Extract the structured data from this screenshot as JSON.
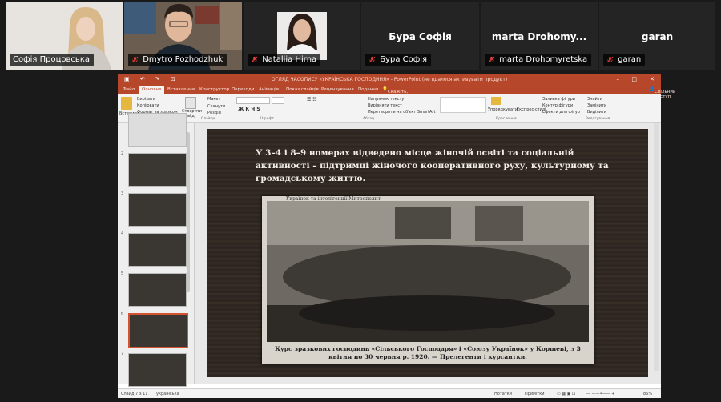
{
  "participants": [
    {
      "name": "Софія Процовська",
      "muted": false,
      "active_speaker": true,
      "has_video": true
    },
    {
      "name": "Dmytro Pozhodzhuk",
      "muted": true,
      "has_video": true
    },
    {
      "name": "Nataliia Hirna",
      "muted": true,
      "has_video": true
    },
    {
      "name": "Бура Софія",
      "display_name": "Бура Софія",
      "muted": true,
      "has_video": false
    },
    {
      "name": "marta Drohomyretska",
      "display_name": "marta Drohomy...",
      "muted": true,
      "has_video": false
    },
    {
      "name": "garan",
      "display_name": "garan",
      "muted": true,
      "has_video": false
    }
  ],
  "app": {
    "title": "ОГЛЯД ЧАСОПИСУ «УКРАЇНСЬКА ГОСПОДИНЯ» - PowerPoint (не вдалося активувати продукт)",
    "tabs": [
      "Файл",
      "Основне",
      "Вставлення",
      "Конструктор",
      "Переходи",
      "Анімація",
      "Показ слайдів",
      "Рецензування",
      "Подання"
    ],
    "tell_me": "Скажіть, що потрібно зробити",
    "share": "Спільний доступ",
    "ribbon_groups": [
      "Буфер обміну",
      "Слайди",
      "Шрифт",
      "Абзац",
      "Креслення",
      "Редагування"
    ],
    "clipboard": [
      "Вирізати",
      "Копіювати",
      "Формат за зразком"
    ],
    "paste": "Вставити",
    "new_slide": "Створити слайд",
    "slides_cmds": [
      "Макет",
      "Скинути",
      "Розділ"
    ],
    "drawing_cmds": [
      "Упорядкувати",
      "Експрес-стилі"
    ],
    "shape_cmds": [
      "Заливка фігури",
      "Контур фігури",
      "Ефекти для фігур"
    ],
    "editing_cmds": [
      "Знайти",
      "Замінити",
      "Виділити"
    ],
    "paragraph_cmds": [
      "Напрямок тексту",
      "Вирівняти текст",
      "Перетворити на об'єкт SmartArt"
    ]
  },
  "thumbnails": [
    {
      "num": "2"
    },
    {
      "num": "3"
    },
    {
      "num": "4"
    },
    {
      "num": "5"
    },
    {
      "num": "6"
    },
    {
      "num": "7",
      "selected": true
    },
    {
      "num": "8"
    }
  ],
  "slide": {
    "text": "У 3–4 і 8–9 номерах відведено місце жіночій освіті та соціальній активності – підтримці жіночого кооперативного руху, культурному та громадському життю.",
    "photo_tag": "Українок та інтелігенції Митрополит",
    "caption": "Курс зразкових господинь «Сільського Господаря» і «Союзу Українок» у Коршеві, з 3 квітня по 30 червня р. 1920. — Прелегенти і курсантки."
  },
  "status": {
    "slide_info": "Слайд 7 з 11",
    "language": "українська",
    "notes": "Нотатки",
    "comments": "Примітки",
    "zoom": "86%"
  },
  "colors": {
    "active_border": "#2ecc40",
    "ppt_accent": "#b7472a",
    "mute": "#e8413b"
  }
}
